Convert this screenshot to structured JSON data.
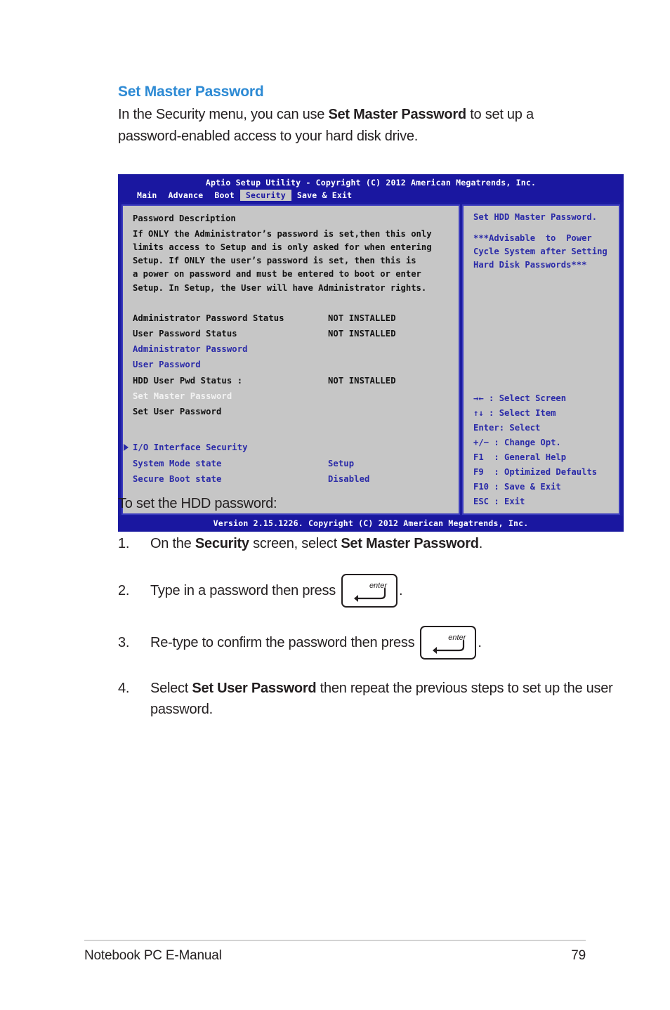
{
  "section": {
    "heading": "Set Master Password",
    "intro_before": "In the Security menu, you can use ",
    "intro_bold": "Set Master Password",
    "intro_after": " to set up a password-enabled access to your hard disk drive."
  },
  "bios": {
    "title": "Aptio Setup Utility - Copyright (C) 2012 American Megatrends, Inc.",
    "tabs": [
      {
        "label": "Main",
        "active": false
      },
      {
        "label": "Advance",
        "active": false
      },
      {
        "label": "Boot",
        "active": false
      },
      {
        "label": "Security",
        "active": true
      },
      {
        "label": "Save & Exit",
        "active": false
      }
    ],
    "left_panel": {
      "description_title": "Password Description",
      "description_lines": [
        "If ONLY the Administrator’s password is set,then this only",
        "limits access to Setup and is only asked for when entering",
        "Setup. If ONLY the user’s password is set, then this is",
        "a power on password and must be entered to boot or enter",
        "Setup. In Setup, the User will have Administrator rights."
      ],
      "items": [
        {
          "label": "Administrator Password Status",
          "value": "NOT INSTALLED",
          "color": "black",
          "marker": false
        },
        {
          "label": "User Password Status",
          "value": "NOT INSTALLED",
          "color": "black",
          "marker": false
        },
        {
          "label": "Administrator Password",
          "value": "",
          "color": "blue",
          "marker": false
        },
        {
          "label": "User Password",
          "value": "",
          "color": "blue",
          "marker": false
        },
        {
          "label": "HDD User Pwd Status :",
          "value": "NOT INSTALLED",
          "color": "black",
          "marker": false
        },
        {
          "label": "Set Master Password",
          "value": "",
          "color": "white",
          "marker": false
        },
        {
          "label": "Set User Password",
          "value": "",
          "color": "black",
          "marker": false
        },
        {
          "label": "I/O Interface Security",
          "value": "",
          "color": "blue",
          "marker": true
        },
        {
          "label": "System Mode state",
          "value": "Setup",
          "color": "blue",
          "marker": false
        },
        {
          "label": "Secure Boot state",
          "value": "Disabled",
          "color": "blue",
          "marker": false
        }
      ]
    },
    "right_panel": {
      "help_lines": [
        "Set HDD Master Password.",
        "***Advisable  to  Power",
        "Cycle System after Setting",
        "Hard Disk Passwords***"
      ],
      "hints": [
        {
          "key": "→← ",
          "sep": ": ",
          "action": "Select Screen"
        },
        {
          "key": "↑↓ ",
          "sep": ": ",
          "action": "Select Item"
        },
        {
          "key": "Enter",
          "sep": ": ",
          "action": "Select"
        },
        {
          "key": "+/− ",
          "sep": ": ",
          "action": "Change Opt."
        },
        {
          "key": "F1  ",
          "sep": ": ",
          "action": "General Help"
        },
        {
          "key": "F9  ",
          "sep": ": ",
          "action": "Optimized Defaults"
        },
        {
          "key": "F10 ",
          "sep": ": ",
          "action": "Save & Exit"
        },
        {
          "key": "ESC ",
          "sep": ": ",
          "action": "Exit"
        }
      ]
    },
    "footer": "Version 2.15.1226. Copyright (C) 2012 American Megatrends, Inc."
  },
  "steps_section": {
    "lead_in": "To set the HDD password:",
    "steps": [
      {
        "number": "1.",
        "parts": [
          {
            "t": "On the ",
            "b": false
          },
          {
            "t": "Security",
            "b": true
          },
          {
            "t": " screen, select ",
            "b": false
          },
          {
            "t": "Set Master Password",
            "b": true
          },
          {
            "t": ".",
            "b": false
          }
        ],
        "key": null
      },
      {
        "number": "2.",
        "parts": [
          {
            "t": "Type in a password then press",
            "b": false
          }
        ],
        "key": "enter",
        "after_key": "."
      },
      {
        "number": "3.",
        "parts": [
          {
            "t": "Re-type to confirm the password then press",
            "b": false
          }
        ],
        "key": "enter",
        "after_key": "."
      },
      {
        "number": "4.",
        "parts": [
          {
            "t": "Select ",
            "b": false
          },
          {
            "t": "Set User Password",
            "b": true
          },
          {
            "t": " then repeat the previous steps to set up the user password.",
            "b": false
          }
        ],
        "key": null
      }
    ],
    "key_label": "enter"
  },
  "page_footer": {
    "left": "Notebook PC E-Manual",
    "right": "79"
  },
  "colors": {
    "heading_blue": "#2d8ad4",
    "bios_background_blue": "#1a17a0",
    "bios_panel_gray": "#c6c6c6",
    "bios_text_blue": "#2a2aa8"
  }
}
